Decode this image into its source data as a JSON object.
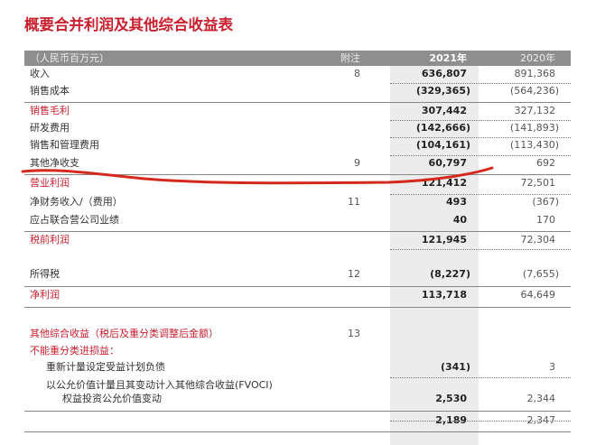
{
  "title": "概要合并利润及其他综合收益表",
  "header": {
    "unit": "（人民币百万元）",
    "note": "附注",
    "y2021": "2021年",
    "y2020": "2020年"
  },
  "rows": [
    {
      "label": "收入",
      "note": "8",
      "v2021": "636,807",
      "v2020": "891,368"
    },
    {
      "label": "销售成本",
      "note": "",
      "v2021": "(329,365)",
      "v2020": "(564,236)"
    },
    {
      "label": "销售毛利",
      "note": "",
      "v2021": "307,442",
      "v2020": "327,132"
    },
    {
      "label": "研发费用",
      "note": "",
      "v2021": "(142,666)",
      "v2020": "(141,893)"
    },
    {
      "label": "销售和管理费用",
      "note": "",
      "v2021": "(104,161)",
      "v2020": "(113,430)"
    },
    {
      "label": "其他净收支",
      "note": "9",
      "v2021": "60,797",
      "v2020": "692"
    },
    {
      "label": "营业利润",
      "note": "",
      "v2021": "121,412",
      "v2020": "72,501"
    },
    {
      "label": "净财务收入/（费用）",
      "note": "11",
      "v2021": "493",
      "v2020": "(367)"
    },
    {
      "label": "应占联合营公司业绩",
      "note": "",
      "v2021": "40",
      "v2020": "170"
    },
    {
      "label": "税前利润",
      "note": "",
      "v2021": "121,945",
      "v2020": "72,304"
    },
    {
      "label": "所得税",
      "note": "12",
      "v2021": "(8,227)",
      "v2020": "(7,655)"
    },
    {
      "label": "净利润",
      "note": "",
      "v2021": "113,718",
      "v2020": "64,649"
    },
    {
      "label": "其他综合收益（税后及重分类调整后金额）",
      "note": "13",
      "v2021": "",
      "v2020": ""
    },
    {
      "label": "不能重分类进损益：",
      "note": "",
      "v2021": "",
      "v2020": ""
    },
    {
      "label": "重新计量设定受益计划负债",
      "note": "",
      "v2021": "(341)",
      "v2020": "3"
    },
    {
      "label": "以公允价值计量且其变动计入其他综合收益(FVOCI)",
      "note": "",
      "v2021": "",
      "v2020": ""
    },
    {
      "label": "权益投资公允价值变动",
      "note": "",
      "v2021": "2,530",
      "v2020": "2,344"
    },
    {
      "label": "",
      "note": "",
      "v2021": "2,189",
      "v2020": "2,347"
    }
  ],
  "colors": {
    "accent": "#c8202f",
    "header_bg": "#8e8e8e",
    "annotation": "#d42a1e"
  }
}
